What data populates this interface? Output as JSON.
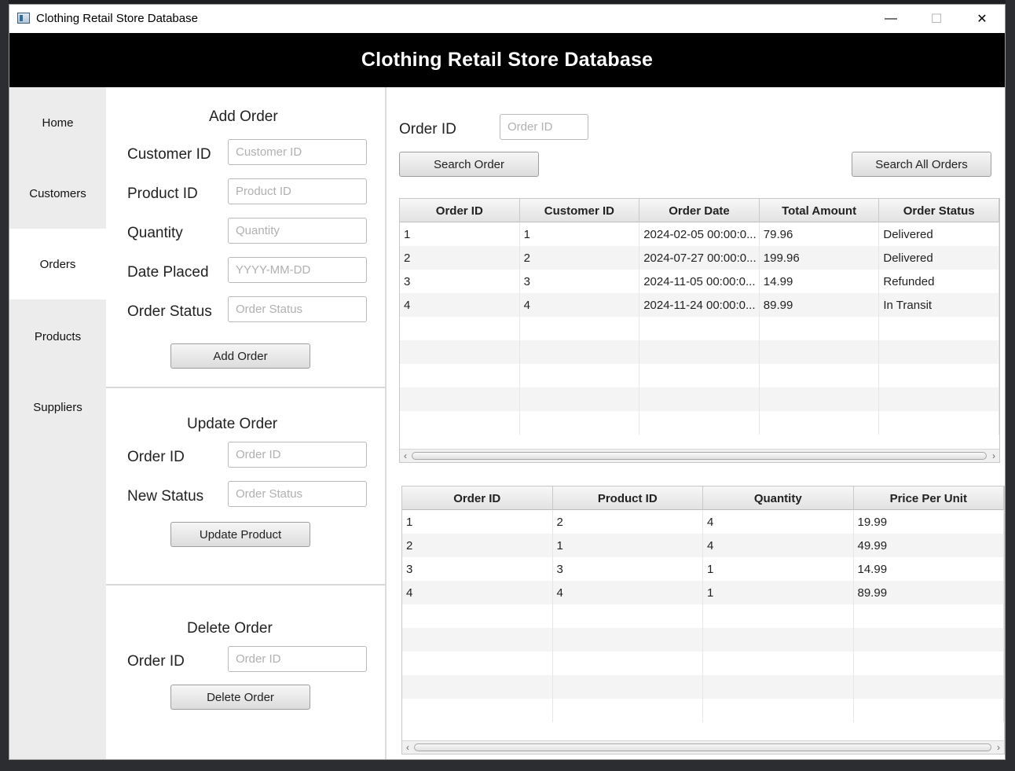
{
  "window": {
    "title": "Clothing Retail Store Database",
    "minimize_label": "—",
    "maximize_label": "☐",
    "close_label": "✕"
  },
  "header": {
    "title": "Clothing Retail Store Database"
  },
  "sidebar": {
    "items": [
      {
        "label": "Home"
      },
      {
        "label": "Customers"
      },
      {
        "label": "Orders",
        "active": true
      },
      {
        "label": "Products"
      },
      {
        "label": "Suppliers"
      }
    ]
  },
  "add_order": {
    "title": "Add Order",
    "fields": [
      {
        "label": "Customer ID",
        "placeholder": "Customer ID"
      },
      {
        "label": "Product ID",
        "placeholder": "Product ID"
      },
      {
        "label": "Quantity",
        "placeholder": "Quantity"
      },
      {
        "label": "Date Placed",
        "placeholder": "YYYY-MM-DD"
      },
      {
        "label": "Order Status",
        "placeholder": "Order Status"
      }
    ],
    "button": "Add Order"
  },
  "update_order": {
    "title": "Update Order",
    "fields": [
      {
        "label": "Order ID",
        "placeholder": "Order ID"
      },
      {
        "label": "New Status",
        "placeholder": "Order Status"
      }
    ],
    "button": "Update Product"
  },
  "delete_order": {
    "title": "Delete Order",
    "fields": [
      {
        "label": "Order ID",
        "placeholder": "Order ID"
      }
    ],
    "button": "Delete Order"
  },
  "search": {
    "label": "Order ID",
    "placeholder": "Order ID",
    "search_button": "Search Order",
    "search_all_button": "Search All Orders"
  },
  "orders_table": {
    "columns": [
      "Order ID",
      "Customer ID",
      "Order Date",
      "Total Amount",
      "Order Status"
    ],
    "rows": [
      [
        "1",
        "1",
        "2024-02-05 00:00:0...",
        "79.96",
        "Delivered"
      ],
      [
        "2",
        "2",
        "2024-07-27 00:00:0...",
        "199.96",
        "Delivered"
      ],
      [
        "3",
        "3",
        "2024-11-05 00:00:0...",
        "14.99",
        "Refunded"
      ],
      [
        "4",
        "4",
        "2024-11-24 00:00:0...",
        "89.99",
        "In Transit"
      ]
    ]
  },
  "order_items_table": {
    "columns": [
      "Order ID",
      "Product ID",
      "Quantity",
      "Price Per Unit"
    ],
    "rows": [
      [
        "1",
        "2",
        "4",
        "19.99"
      ],
      [
        "2",
        "1",
        "4",
        "49.99"
      ],
      [
        "3",
        "3",
        "1",
        "14.99"
      ],
      [
        "4",
        "4",
        "1",
        "89.99"
      ]
    ]
  },
  "scrollbar": {
    "left_arrow": "‹",
    "right_arrow": "›"
  }
}
